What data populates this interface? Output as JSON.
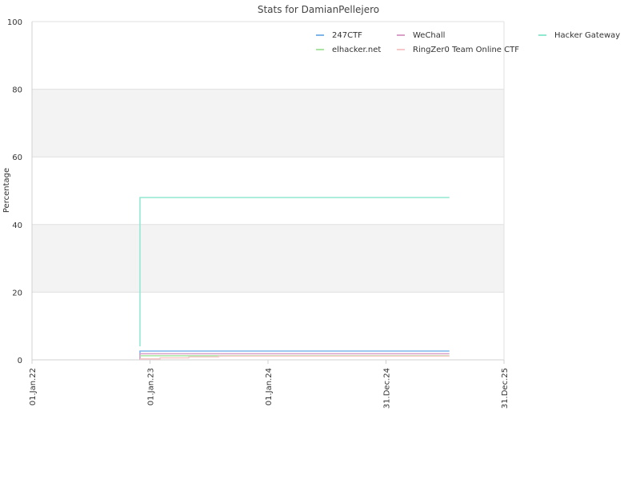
{
  "chart_data": {
    "type": "line",
    "title": "Stats for DamianPellejero",
    "xlabel": "",
    "ylabel": "Percentage",
    "xlim": [
      "2022-01-01",
      "2025-12-31"
    ],
    "ylim": [
      0,
      100
    ],
    "y_ticks": [
      0,
      20,
      40,
      60,
      80,
      100
    ],
    "x_ticks": [
      {
        "date": "2022-01-01",
        "label": "01.Jan.22"
      },
      {
        "date": "2023-01-01",
        "label": "01.Jan.23"
      },
      {
        "date": "2024-01-01",
        "label": "01.Jan.24"
      },
      {
        "date": "2024-12-31",
        "label": "31.Dec.24"
      },
      {
        "date": "2025-12-31",
        "label": "31.Dec.25"
      }
    ],
    "grid": true,
    "legend_position": "top-right",
    "series": [
      {
        "name": "247CTF",
        "color": "#7cb5ec",
        "points": [
          [
            "2022-12-01",
            0.2
          ],
          [
            "2022-12-01",
            2.6
          ],
          [
            "2025-07-15",
            2.6
          ]
        ]
      },
      {
        "name": "WeChall",
        "color": "#d8a0c8",
        "points": [
          [
            "2022-12-01",
            0.1
          ],
          [
            "2022-12-01",
            1.8
          ],
          [
            "2025-07-15",
            1.8
          ]
        ]
      },
      {
        "name": "Hacker Gateway",
        "color": "#8fe8d0",
        "points": [
          [
            "2022-12-01",
            4.0
          ],
          [
            "2022-12-01",
            48.0
          ],
          [
            "2025-07-15",
            48.0
          ]
        ]
      },
      {
        "name": "elhacker.net",
        "color": "#a8e6a0",
        "points": [
          [
            "2022-12-01",
            1.2
          ],
          [
            "2025-07-15",
            1.2
          ]
        ]
      },
      {
        "name": "RingZer0 Team Online CTF",
        "color": "#f7c8c8",
        "points": [
          [
            "2022-12-01",
            0.3
          ],
          [
            "2023-02-01",
            0.3
          ],
          [
            "2023-02-01",
            0.6
          ],
          [
            "2023-05-01",
            0.6
          ],
          [
            "2023-05-01",
            0.9
          ],
          [
            "2023-08-01",
            0.9
          ],
          [
            "2023-08-01",
            1.1
          ],
          [
            "2025-07-15",
            1.1
          ]
        ]
      }
    ]
  }
}
